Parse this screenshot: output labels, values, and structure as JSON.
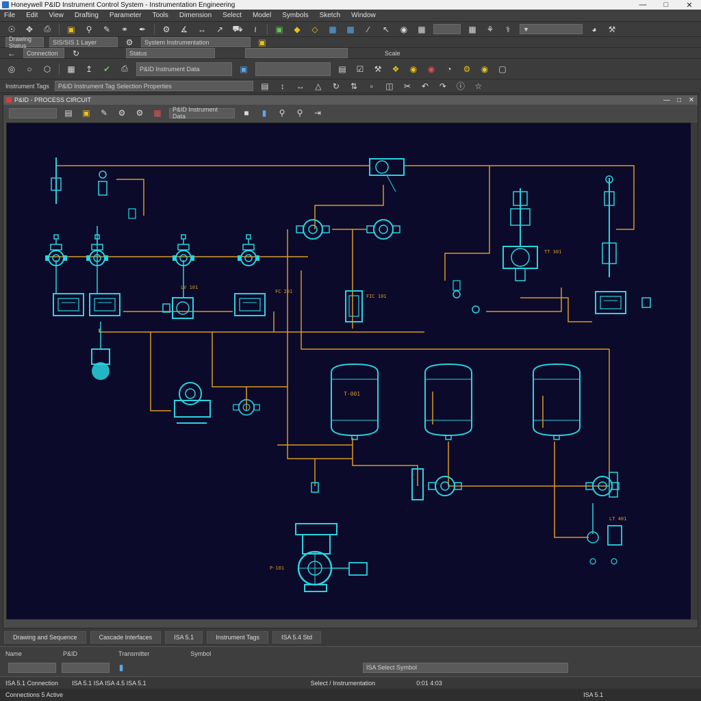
{
  "window": {
    "title": "Honeywell P&ID Instrument Control System - Instrumentation Engineering"
  },
  "menu": [
    "File",
    "Edit",
    "View",
    "Drafting",
    "Parameter",
    "Tools",
    "Dimension",
    "Select",
    "Model",
    "Symbols",
    "Sketch",
    "Window"
  ],
  "toolbar_row2": {
    "combo_left": "Drawing Status",
    "combo_layer": "SIS/SIS 1 Layer",
    "combo_mid": "System Instrumentation"
  },
  "toolbar_row3": {
    "combo_left": "Connection",
    "combo_right": "Status",
    "label_right": "Scale"
  },
  "toolbar_row4": {
    "combo_main": "P&ID Instrument Data"
  },
  "toolbar_row5": {
    "label": "Instrument Tags",
    "combo": "P&ID Instrument Tag Selection Properties"
  },
  "doc": {
    "title": "P&ID - PROCESS CIRCUIT",
    "toolbar_combo": "P&ID Instrument Data"
  },
  "canvas_labels": {
    "tank1": "T-001",
    "tag_vx": "LV 101",
    "tag_fc": "FC 201",
    "tag_tl": "TT 301",
    "tag_flow": "FIC 101",
    "tag_pump": "P-101",
    "tag_lt": "LT 401"
  },
  "bottom_tabs": [
    "Drawing and Sequence",
    "Cascade Interfaces",
    "ISA 5.1",
    "Instrument Tags",
    "ISA 5.4 Std"
  ],
  "props": {
    "c1": "Name",
    "c2": "P&ID",
    "c3": "Transmitter",
    "c4": "Symbol",
    "value": "ISA Select Symbol"
  },
  "statusbar": {
    "left": "ISA 5.1 Connection",
    "mid": "ISA 5.1 ISA ISA 4.5 ISA 5.1",
    "right": "Select / Instrumentation",
    "coords": "0:01 4:03"
  },
  "statusbar2": {
    "left": "Connections 5 Active",
    "right": "ISA 5.1"
  },
  "colors": {
    "canvas_bg": "#0c0a2a",
    "equipment": "#29d4e0",
    "pipe": "#d99a22"
  }
}
